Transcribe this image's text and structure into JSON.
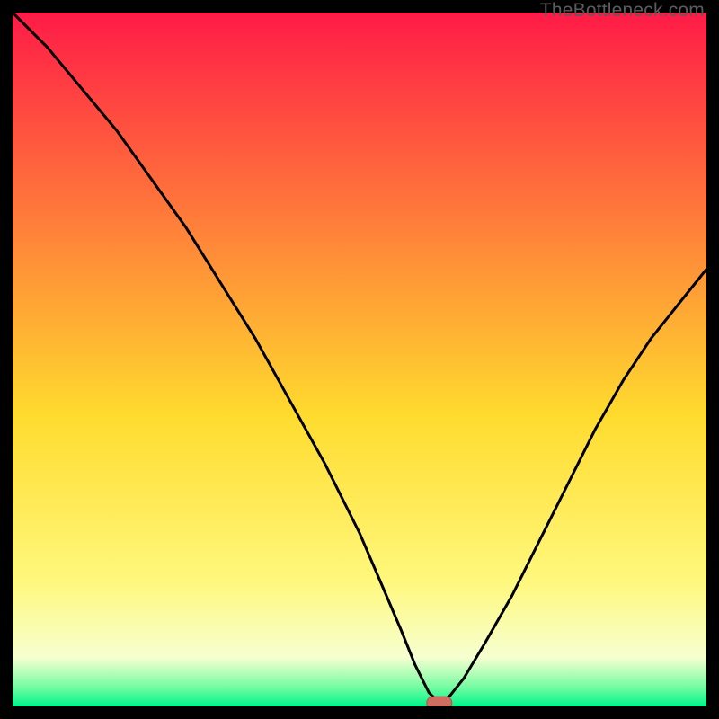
{
  "watermark": "TheBottleneck.com",
  "colors": {
    "grad_top": "#ff1b47",
    "grad_mid_upper": "#ff7d3a",
    "grad_mid": "#ffdb2e",
    "grad_mid_lower": "#fff87d",
    "grad_pale": "#f6ffd0",
    "grad_green_mid": "#7cfca4",
    "grad_green": "#00f58a",
    "curve": "#000000",
    "marker_fill": "#cf6d62",
    "marker_stroke": "#b55348",
    "frame": "#000000"
  },
  "chart_data": {
    "type": "line",
    "title": "",
    "xlabel": "",
    "ylabel": "",
    "xlim": [
      0,
      100
    ],
    "ylim": [
      0,
      100
    ],
    "series": [
      {
        "name": "bottleneck-curve",
        "x": [
          0,
          5,
          10,
          15,
          20,
          25,
          30,
          35,
          40,
          45,
          50,
          53,
          56,
          58,
          60,
          61.5,
          63,
          65,
          68,
          72,
          76,
          80,
          84,
          88,
          92,
          96,
          100
        ],
        "y": [
          100,
          95,
          89,
          83,
          76,
          69,
          61,
          53,
          44,
          35,
          25,
          18,
          11,
          6,
          2,
          0.5,
          1.5,
          4,
          9,
          16,
          24,
          32,
          40,
          47,
          53,
          58,
          63
        ]
      }
    ],
    "optimum_marker": {
      "x": 61.5,
      "y": 0.5
    }
  }
}
